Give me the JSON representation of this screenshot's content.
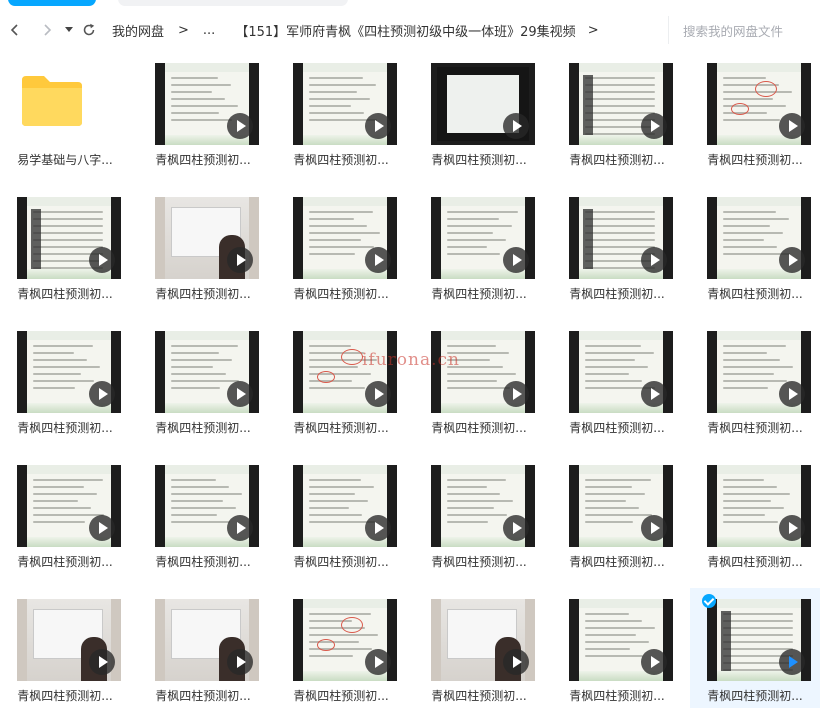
{
  "breadcrumb": {
    "items": [
      "我的网盘",
      "...",
      "【151】军师府青枫《四柱预测初级中级一体班》29集视频"
    ],
    "separator": ">"
  },
  "search": {
    "placeholder": "搜索我的网盘文件"
  },
  "files": [
    {
      "name": "易学基础与八字...",
      "kind": "folder"
    },
    {
      "name": "青枫四柱预测初...",
      "kind": "video"
    },
    {
      "name": "青枫四柱预测初...",
      "kind": "video"
    },
    {
      "name": "青枫四柱预测初...",
      "kind": "video"
    },
    {
      "name": "青枫四柱预测初...",
      "kind": "video"
    },
    {
      "name": "青枫四柱预测初...",
      "kind": "video"
    },
    {
      "name": "青枫四柱预测初...",
      "kind": "video"
    },
    {
      "name": "青枫四柱预测初...",
      "kind": "video"
    },
    {
      "name": "青枫四柱预测初...",
      "kind": "video"
    },
    {
      "name": "青枫四柱预测初...",
      "kind": "video"
    },
    {
      "name": "青枫四柱预测初...",
      "kind": "video"
    },
    {
      "name": "青枫四柱预测初...",
      "kind": "video"
    },
    {
      "name": "青枫四柱预测初...",
      "kind": "video"
    },
    {
      "name": "青枫四柱预测初...",
      "kind": "video"
    },
    {
      "name": "青枫四柱预测初...",
      "kind": "video"
    },
    {
      "name": "青枫四柱预测初...",
      "kind": "video"
    },
    {
      "name": "青枫四柱预测初...",
      "kind": "video"
    },
    {
      "name": "青枫四柱预测初...",
      "kind": "video"
    },
    {
      "name": "青枫四柱预测初...",
      "kind": "video"
    },
    {
      "name": "青枫四柱预测初...",
      "kind": "video"
    },
    {
      "name": "青枫四柱预测初...",
      "kind": "video"
    },
    {
      "name": "青枫四柱预测初...",
      "kind": "video"
    },
    {
      "name": "青枫四柱预测初...",
      "kind": "video"
    },
    {
      "name": "青枫四柱预测初...",
      "kind": "video"
    },
    {
      "name": "青枫四柱预测初...",
      "kind": "video"
    },
    {
      "name": "青枫四柱预测初...",
      "kind": "video"
    },
    {
      "name": "青枫四柱预测初...",
      "kind": "video"
    },
    {
      "name": "青枫四柱预测初...",
      "kind": "video"
    },
    {
      "name": "青枫四柱预测初...",
      "kind": "video"
    },
    {
      "name": "青枫四柱预测初...",
      "kind": "video",
      "selected": true
    }
  ],
  "watermark": "ifurona.cn",
  "colors": {
    "accent": "#06a7ff",
    "folder": "#ffd44f",
    "selected_bg": "#edf6ff"
  }
}
